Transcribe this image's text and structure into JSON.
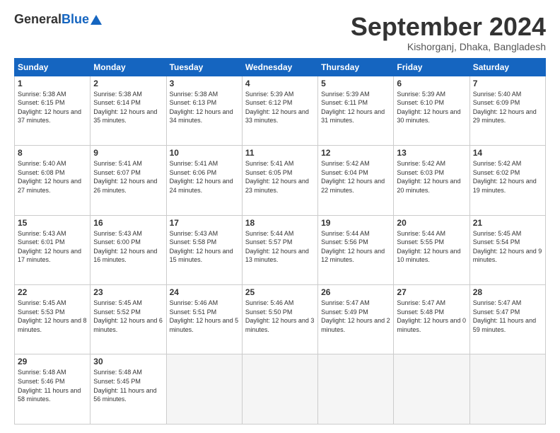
{
  "header": {
    "logo_general": "General",
    "logo_blue": "Blue",
    "month_title": "September 2024",
    "location": "Kishorganj, Dhaka, Bangladesh"
  },
  "days_of_week": [
    "Sunday",
    "Monday",
    "Tuesday",
    "Wednesday",
    "Thursday",
    "Friday",
    "Saturday"
  ],
  "weeks": [
    [
      {
        "day": "1",
        "sunrise": "5:38 AM",
        "sunset": "6:15 PM",
        "daylight": "12 hours and 37 minutes."
      },
      {
        "day": "2",
        "sunrise": "5:38 AM",
        "sunset": "6:14 PM",
        "daylight": "12 hours and 35 minutes."
      },
      {
        "day": "3",
        "sunrise": "5:38 AM",
        "sunset": "6:13 PM",
        "daylight": "12 hours and 34 minutes."
      },
      {
        "day": "4",
        "sunrise": "5:39 AM",
        "sunset": "6:12 PM",
        "daylight": "12 hours and 33 minutes."
      },
      {
        "day": "5",
        "sunrise": "5:39 AM",
        "sunset": "6:11 PM",
        "daylight": "12 hours and 31 minutes."
      },
      {
        "day": "6",
        "sunrise": "5:39 AM",
        "sunset": "6:10 PM",
        "daylight": "12 hours and 30 minutes."
      },
      {
        "day": "7",
        "sunrise": "5:40 AM",
        "sunset": "6:09 PM",
        "daylight": "12 hours and 29 minutes."
      }
    ],
    [
      {
        "day": "8",
        "sunrise": "5:40 AM",
        "sunset": "6:08 PM",
        "daylight": "12 hours and 27 minutes."
      },
      {
        "day": "9",
        "sunrise": "5:41 AM",
        "sunset": "6:07 PM",
        "daylight": "12 hours and 26 minutes."
      },
      {
        "day": "10",
        "sunrise": "5:41 AM",
        "sunset": "6:06 PM",
        "daylight": "12 hours and 24 minutes."
      },
      {
        "day": "11",
        "sunrise": "5:41 AM",
        "sunset": "6:05 PM",
        "daylight": "12 hours and 23 minutes."
      },
      {
        "day": "12",
        "sunrise": "5:42 AM",
        "sunset": "6:04 PM",
        "daylight": "12 hours and 22 minutes."
      },
      {
        "day": "13",
        "sunrise": "5:42 AM",
        "sunset": "6:03 PM",
        "daylight": "12 hours and 20 minutes."
      },
      {
        "day": "14",
        "sunrise": "5:42 AM",
        "sunset": "6:02 PM",
        "daylight": "12 hours and 19 minutes."
      }
    ],
    [
      {
        "day": "15",
        "sunrise": "5:43 AM",
        "sunset": "6:01 PM",
        "daylight": "12 hours and 17 minutes."
      },
      {
        "day": "16",
        "sunrise": "5:43 AM",
        "sunset": "6:00 PM",
        "daylight": "12 hours and 16 minutes."
      },
      {
        "day": "17",
        "sunrise": "5:43 AM",
        "sunset": "5:58 PM",
        "daylight": "12 hours and 15 minutes."
      },
      {
        "day": "18",
        "sunrise": "5:44 AM",
        "sunset": "5:57 PM",
        "daylight": "12 hours and 13 minutes."
      },
      {
        "day": "19",
        "sunrise": "5:44 AM",
        "sunset": "5:56 PM",
        "daylight": "12 hours and 12 minutes."
      },
      {
        "day": "20",
        "sunrise": "5:44 AM",
        "sunset": "5:55 PM",
        "daylight": "12 hours and 10 minutes."
      },
      {
        "day": "21",
        "sunrise": "5:45 AM",
        "sunset": "5:54 PM",
        "daylight": "12 hours and 9 minutes."
      }
    ],
    [
      {
        "day": "22",
        "sunrise": "5:45 AM",
        "sunset": "5:53 PM",
        "daylight": "12 hours and 8 minutes."
      },
      {
        "day": "23",
        "sunrise": "5:45 AM",
        "sunset": "5:52 PM",
        "daylight": "12 hours and 6 minutes."
      },
      {
        "day": "24",
        "sunrise": "5:46 AM",
        "sunset": "5:51 PM",
        "daylight": "12 hours and 5 minutes."
      },
      {
        "day": "25",
        "sunrise": "5:46 AM",
        "sunset": "5:50 PM",
        "daylight": "12 hours and 3 minutes."
      },
      {
        "day": "26",
        "sunrise": "5:47 AM",
        "sunset": "5:49 PM",
        "daylight": "12 hours and 2 minutes."
      },
      {
        "day": "27",
        "sunrise": "5:47 AM",
        "sunset": "5:48 PM",
        "daylight": "12 hours and 0 minutes."
      },
      {
        "day": "28",
        "sunrise": "5:47 AM",
        "sunset": "5:47 PM",
        "daylight": "11 hours and 59 minutes."
      }
    ],
    [
      {
        "day": "29",
        "sunrise": "5:48 AM",
        "sunset": "5:46 PM",
        "daylight": "11 hours and 58 minutes."
      },
      {
        "day": "30",
        "sunrise": "5:48 AM",
        "sunset": "5:45 PM",
        "daylight": "11 hours and 56 minutes."
      },
      null,
      null,
      null,
      null,
      null
    ]
  ]
}
